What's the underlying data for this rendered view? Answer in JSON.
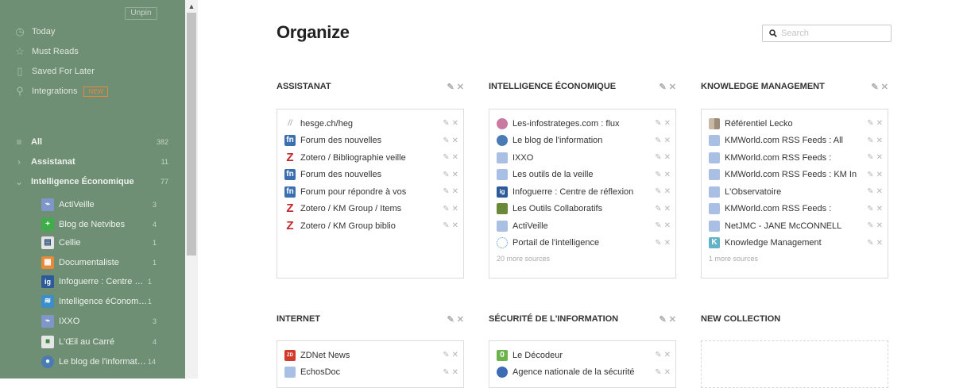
{
  "sidebar": {
    "unpin_label": "Unpin",
    "nav": [
      {
        "label": "Today",
        "icon": "clock-icon"
      },
      {
        "label": "Must Reads",
        "icon": "star-icon"
      },
      {
        "label": "Saved For Later",
        "icon": "bookmark-icon"
      },
      {
        "label": "Integrations",
        "icon": "integrations-icon",
        "badge": "NEW"
      }
    ],
    "all": {
      "label": "All",
      "count": "382"
    },
    "assistanat": {
      "label": "Assistanat",
      "count": "11"
    },
    "intelligence": {
      "label": "Intelligence Économique",
      "count": "77"
    },
    "feeds": [
      {
        "label": "ActiVeille",
        "count": "3"
      },
      {
        "label": "Blog de Netvibes",
        "count": "4"
      },
      {
        "label": "Cellie",
        "count": "1"
      },
      {
        "label": "Documentaliste",
        "count": "1"
      },
      {
        "label": "Infoguerre : Centre de…",
        "count": "1"
      },
      {
        "label": "Intelligence éConomi…",
        "count": "1"
      },
      {
        "label": "IXXO",
        "count": "3"
      },
      {
        "label": "L'Œil au Carré",
        "count": "4"
      },
      {
        "label": "Le blog de l'informat…",
        "count": "14"
      }
    ]
  },
  "main": {
    "title": "Organize",
    "search_placeholder": "Search",
    "collections": [
      {
        "title": "ASSISTANAT",
        "sources": [
          {
            "label": "hesge.ch/heg",
            "fav": "f-slash",
            "glyph": "//"
          },
          {
            "label": "Forum des nouvelles",
            "fav": "f-fn",
            "glyph": "fn"
          },
          {
            "label": "Zotero / Bibliographie veille",
            "fav": "f-z",
            "glyph": "Z"
          },
          {
            "label": "Forum des nouvelles",
            "fav": "f-fn",
            "glyph": "fn"
          },
          {
            "label": "Forum pour répondre à vos",
            "fav": "f-fn",
            "glyph": "fn"
          },
          {
            "label": "Zotero / KM Group / Items",
            "fav": "f-z",
            "glyph": "Z"
          },
          {
            "label": "Zotero / KM Group biblio",
            "fav": "f-z",
            "glyph": "Z"
          }
        ],
        "more": ""
      },
      {
        "title": "INTELLIGENCE ÉCONOMIQUE",
        "sources": [
          {
            "label": "Les-infostrateges.com : flux",
            "fav": "f-brain",
            "glyph": ""
          },
          {
            "label": "Le blog de l'information",
            "fav": "f-blog",
            "glyph": ""
          },
          {
            "label": "IXXO",
            "fav": "f-rss-light",
            "glyph": ""
          },
          {
            "label": "Les outils de la veille",
            "fav": "f-rss-light",
            "glyph": ""
          },
          {
            "label": "Infoguerre : Centre de réflexion",
            "fav": "f-ig",
            "glyph": "ig"
          },
          {
            "label": "Les Outils Collaboratifs",
            "fav": "f-collab",
            "glyph": ""
          },
          {
            "label": "ActiVeille",
            "fav": "f-rss-light",
            "glyph": ""
          },
          {
            "label": "Portail de l'intelligence",
            "fav": "f-portal",
            "glyph": ""
          }
        ],
        "more": "20 more sources"
      },
      {
        "title": "KNOWLEDGE MANAGEMENT",
        "sources": [
          {
            "label": "Référentiel Lecko",
            "fav": "f-lecko",
            "glyph": ""
          },
          {
            "label": "KMWorld.com RSS Feeds : All",
            "fav": "f-rss-light",
            "glyph": ""
          },
          {
            "label": "KMWorld.com RSS Feeds :",
            "fav": "f-rss-light",
            "glyph": ""
          },
          {
            "label": "KMWorld.com RSS Feeds : KM In",
            "fav": "f-rss-light",
            "glyph": ""
          },
          {
            "label": "L'Observatoire",
            "fav": "f-rss-light",
            "glyph": ""
          },
          {
            "label": "KMWorld.com RSS Feeds :",
            "fav": "f-rss-light",
            "glyph": ""
          },
          {
            "label": "NetJMC - JANE McCONNELL",
            "fav": "f-rss-light",
            "glyph": ""
          },
          {
            "label": "Knowledge Management",
            "fav": "f-k",
            "glyph": "K"
          }
        ],
        "more": "1 more sources"
      },
      {
        "title": "INTERNET",
        "sources": [
          {
            "label": "ZDNet News",
            "fav": "f-zd",
            "glyph": "ZD"
          },
          {
            "label": "EchosDoc",
            "fav": "f-rss-light",
            "glyph": ""
          }
        ],
        "more": ""
      },
      {
        "title": "SÉCURITÉ DE L'INFORMATION",
        "sources": [
          {
            "label": "Le Décodeur",
            "fav": "f-green",
            "glyph": "0"
          },
          {
            "label": "Agence nationale de la sécurité",
            "fav": "f-anssi",
            "glyph": ""
          }
        ],
        "more": ""
      },
      {
        "title": "NEW COLLECTION",
        "sources": [],
        "more": ""
      }
    ]
  },
  "colors": {
    "sidebar_bg": "#6e8f73",
    "new_badge": "#e8883a",
    "text": "#333333"
  }
}
